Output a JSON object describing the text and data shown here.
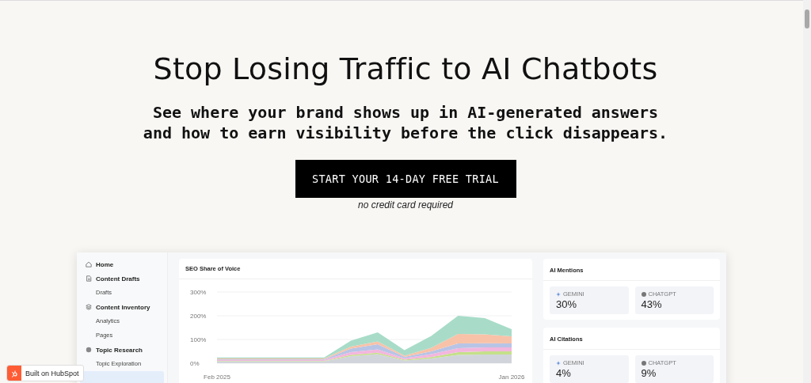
{
  "hero": {
    "title": "Stop Losing Traffic to AI Chatbots",
    "subtitle_lines": [
      "See where your brand shows up in AI-generated answers",
      "and how to earn visibility before the click disappears."
    ],
    "cta": "START YOUR 14-DAY FREE TRIAL",
    "note": "no credit card required"
  },
  "sidebar": {
    "items": [
      {
        "label": "Home",
        "kind": "section",
        "selected": false
      },
      {
        "label": "Content Drafts",
        "kind": "section",
        "selected": false
      },
      {
        "label": "Drafts",
        "kind": "sub",
        "selected": false
      },
      {
        "label": "Content Inventory",
        "kind": "section",
        "selected": false
      },
      {
        "label": "Analytics",
        "kind": "sub",
        "selected": false
      },
      {
        "label": "Pages",
        "kind": "sub",
        "selected": false
      },
      {
        "label": "Topic Research",
        "kind": "section",
        "selected": false
      },
      {
        "label": "Topic Exploration",
        "kind": "sub",
        "selected": false
      },
      {
        "kind": "sub",
        "selected": true
      }
    ]
  },
  "chart_card": {
    "title": "SEO Share of Voice",
    "chart_data": {
      "type": "area",
      "stacked": true,
      "categories": [
        "Feb 2025",
        null,
        null,
        null,
        null,
        null,
        null,
        null,
        null,
        null,
        null,
        "Jan 2026"
      ],
      "yticks": [
        {
          "value": 0,
          "label": "0%"
        },
        {
          "value": 100,
          "label": "100%"
        },
        {
          "value": 200,
          "label": "200%"
        },
        {
          "value": 300,
          "label": "300%"
        }
      ],
      "ylim": [
        0,
        300
      ],
      "series": [
        {
          "color": "#d1d5db",
          "values": [
            8,
            8,
            8,
            8,
            8,
            30,
            38,
            12,
            20,
            35,
            37,
            37
          ]
        },
        {
          "color": "#c5e08a",
          "values": [
            2,
            2,
            2,
            2,
            2,
            5,
            6,
            3,
            6,
            12,
            13,
            13
          ]
        },
        {
          "color": "#f3b6dd",
          "values": [
            4,
            4,
            4,
            4,
            4,
            12,
            14,
            6,
            12,
            16,
            17,
            17
          ]
        },
        {
          "color": "#b8c4e6",
          "values": [
            3,
            3,
            3,
            3,
            3,
            15,
            22,
            6,
            12,
            20,
            17,
            16
          ]
        },
        {
          "color": "#f8c2a8",
          "values": [
            3,
            3,
            3,
            3,
            3,
            8,
            12,
            5,
            15,
            40,
            38,
            30
          ]
        },
        {
          "color": "#a8dcc8",
          "values": [
            4,
            4,
            4,
            4,
            4,
            25,
            38,
            23,
            50,
            77,
            68,
            30
          ]
        }
      ]
    }
  },
  "metric_cards": [
    {
      "title": "AI Mentions",
      "stats": [
        {
          "source": "GEMINI",
          "value": "30%"
        },
        {
          "source": "CHATGPT",
          "value": "43%"
        }
      ]
    },
    {
      "title": "AI Citations",
      "stats": [
        {
          "source": "GEMINI",
          "value": "4%"
        },
        {
          "source": "CHATGPT",
          "value": "9%"
        }
      ]
    }
  ],
  "badge": {
    "label": "Built on HubSpot"
  }
}
